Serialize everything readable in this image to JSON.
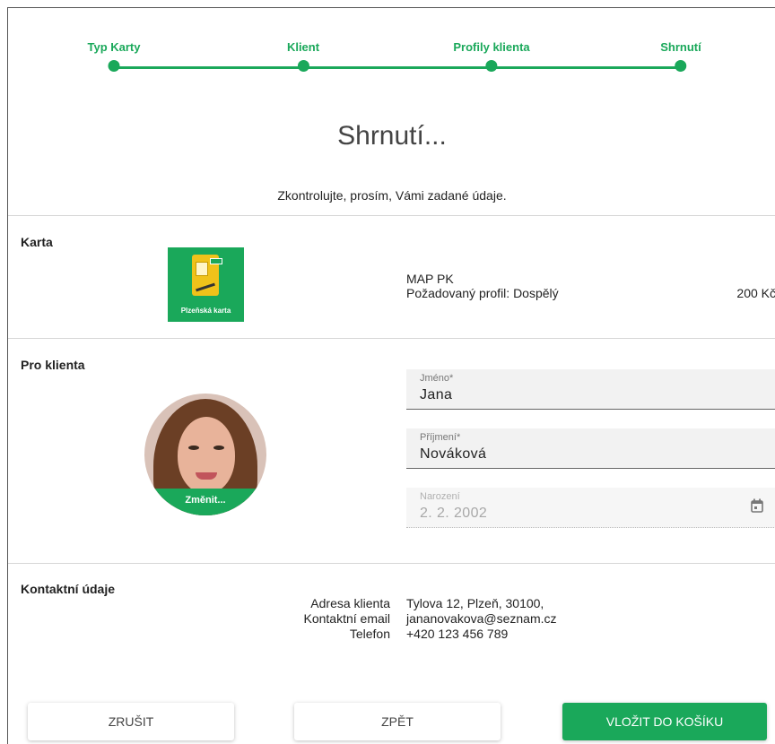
{
  "stepper": {
    "steps": [
      {
        "label": "Typ Karty"
      },
      {
        "label": "Klient"
      },
      {
        "label": "Profily klienta"
      },
      {
        "label": "Shrnutí"
      }
    ]
  },
  "page": {
    "title": "Shrnutí...",
    "subtitle": "Zkontrolujte, prosím, Vámi zadané údaje."
  },
  "card_section": {
    "heading": "Karta",
    "image_caption": "Plzeňská karta",
    "name": "MAP PK",
    "profile": "Požadovaný profil: Dospělý",
    "price": "200 Kč"
  },
  "client_section": {
    "heading": "Pro klienta",
    "change_photo_label": "Změnit...",
    "fields": {
      "first_name": {
        "label": "Jméno*",
        "value": "Jana"
      },
      "last_name": {
        "label": "Příjmení*",
        "value": "Nováková"
      },
      "birth": {
        "label": "Narození",
        "value": "2. 2. 2002"
      }
    }
  },
  "contact_section": {
    "heading": "Kontaktní údaje",
    "address_label": "Adresa klienta",
    "address_value": "Tylova 12, Plzeň, 30100,",
    "email_label": "Kontaktní email",
    "email_value": "jananovakova@seznam.cz",
    "phone_label": "Telefon",
    "phone_value": "+420 123 456 789"
  },
  "actions": {
    "cancel_label": "ZRUŠIT",
    "back_label": "ZPĚT",
    "add_to_cart_label": "VLOŽIT DO KOŠÍKU"
  },
  "colors": {
    "accent": "#1aa85a"
  }
}
